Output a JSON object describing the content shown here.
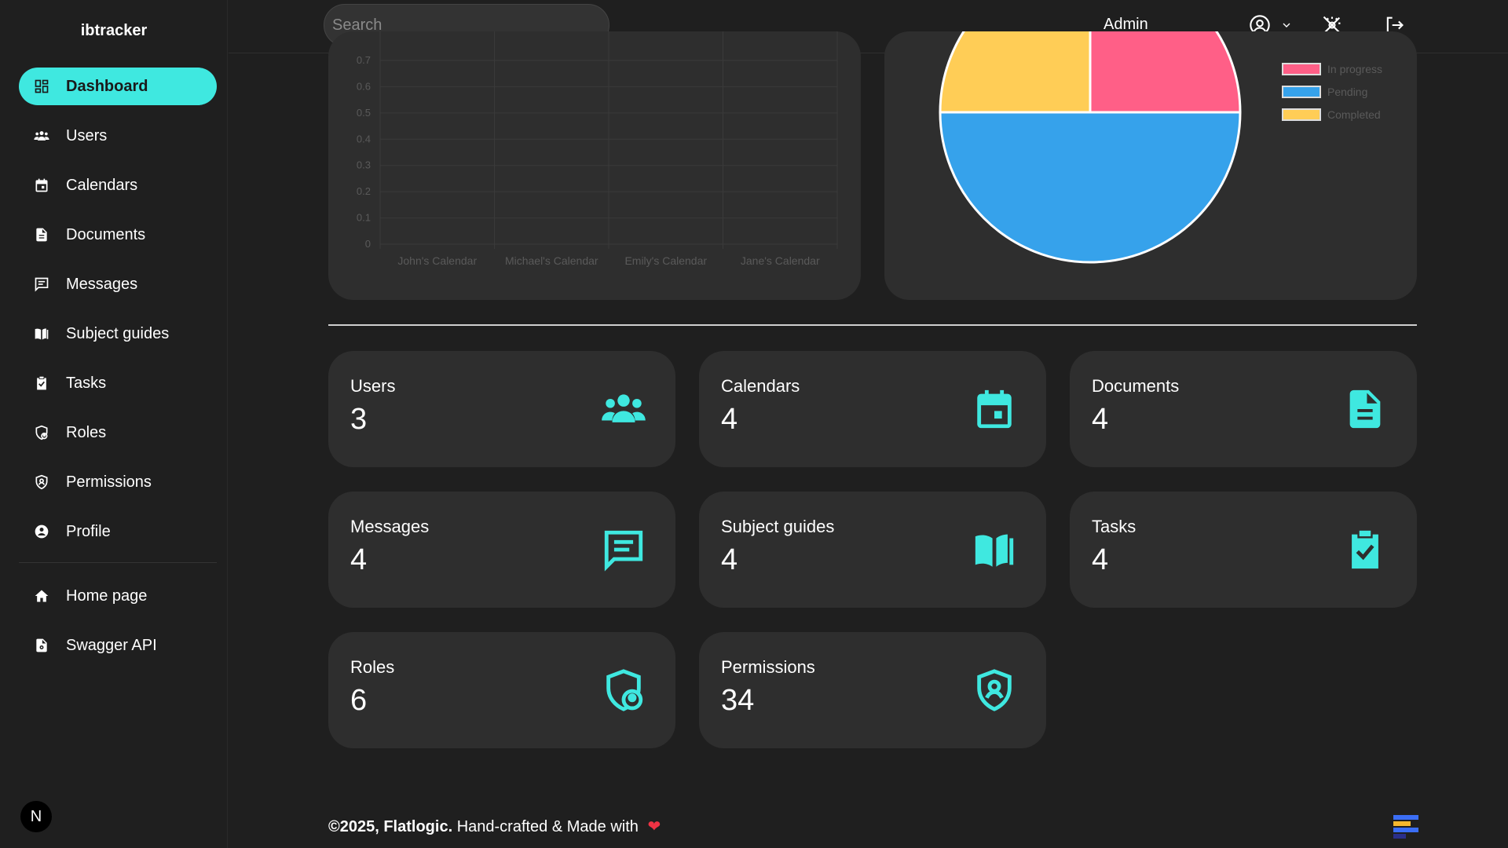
{
  "brand": "ibtracker",
  "sidebar": {
    "items": [
      {
        "label": "Dashboard",
        "icon": "dashboard-icon",
        "active": true
      },
      {
        "label": "Users",
        "icon": "users-icon"
      },
      {
        "label": "Calendars",
        "icon": "calendar-icon"
      },
      {
        "label": "Documents",
        "icon": "document-icon"
      },
      {
        "label": "Messages",
        "icon": "message-icon"
      },
      {
        "label": "Subject guides",
        "icon": "book-icon"
      },
      {
        "label": "Tasks",
        "icon": "clipboard-check-icon"
      },
      {
        "label": "Roles",
        "icon": "shield-user-icon"
      },
      {
        "label": "Permissions",
        "icon": "shield-icon"
      },
      {
        "label": "Profile",
        "icon": "user-circle-icon"
      }
    ],
    "footer_items": [
      {
        "label": "Home page",
        "icon": "home-icon"
      },
      {
        "label": "Swagger API",
        "icon": "file-api-icon"
      }
    ],
    "avatar_initial": "N"
  },
  "topbar": {
    "search_placeholder": "Search",
    "user_label": "Admin"
  },
  "colors": {
    "accent": "#3fe8e0",
    "card": "#2e2e2e",
    "background": "#1f1f1f",
    "pink": "#ff5f87",
    "blue": "#36a2eb",
    "yellow": "#ffcd56"
  },
  "chart_data": [
    {
      "type": "bar",
      "categories": [
        "John's Calendar",
        "Michael's Calendar",
        "Emily's Calendar",
        "Jane's Calendar"
      ],
      "values": [
        0,
        0,
        0,
        0
      ],
      "yticks": [
        "0",
        "0.1",
        "0.2",
        "0.3",
        "0.4",
        "0.5",
        "0.6",
        "0.7"
      ],
      "ylim": [
        0,
        0.7
      ]
    },
    {
      "type": "pie",
      "labels": [
        "In progress",
        "Pending",
        "Completed"
      ],
      "values": [
        1,
        2,
        1
      ],
      "colors": [
        "#ff5f87",
        "#36a2eb",
        "#ffcd56"
      ]
    }
  ],
  "stats": [
    {
      "label": "Users",
      "value": "3",
      "icon": "users-icon"
    },
    {
      "label": "Calendars",
      "value": "4",
      "icon": "calendar-icon"
    },
    {
      "label": "Documents",
      "value": "4",
      "icon": "document-icon"
    },
    {
      "label": "Messages",
      "value": "4",
      "icon": "message-icon"
    },
    {
      "label": "Subject guides",
      "value": "4",
      "icon": "book-icon"
    },
    {
      "label": "Tasks",
      "value": "4",
      "icon": "clipboard-check-icon"
    },
    {
      "label": "Roles",
      "value": "6",
      "icon": "shield-user-icon"
    },
    {
      "label": "Permissions",
      "value": "34",
      "icon": "shield-icon"
    }
  ],
  "footer": {
    "copyright": "©2025, Flatlogic.",
    "tagline": "Hand-crafted & Made with"
  }
}
